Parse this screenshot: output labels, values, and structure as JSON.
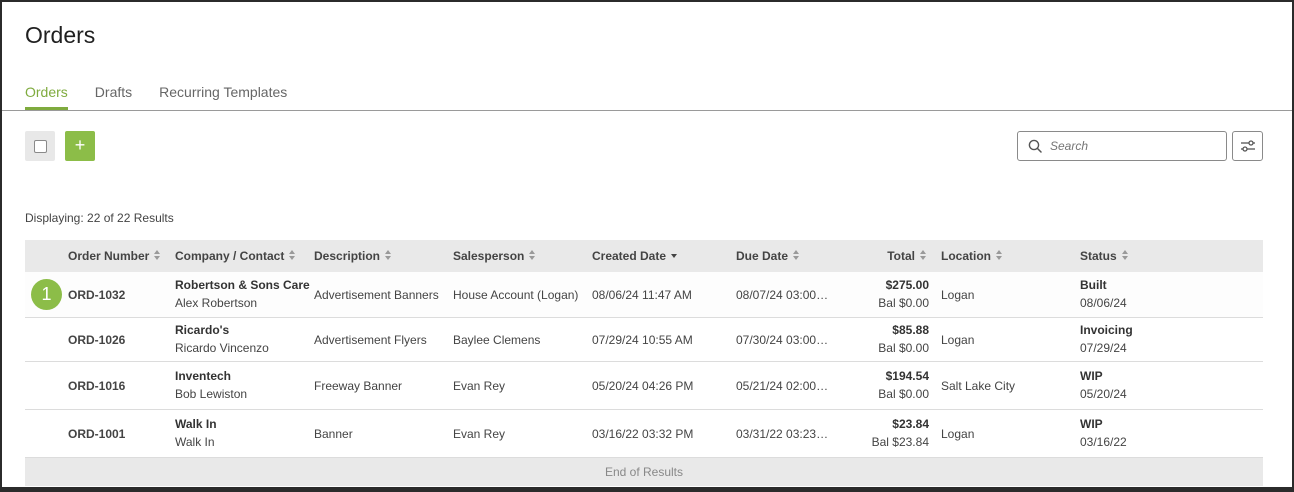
{
  "page": {
    "title": "Orders"
  },
  "tabs": [
    {
      "label": "Orders",
      "active": true
    },
    {
      "label": "Drafts",
      "active": false
    },
    {
      "label": "Recurring Templates",
      "active": false
    }
  ],
  "toolbar": {
    "add_label": "+",
    "search_placeholder": "Search",
    "search_icon": "search-icon",
    "filter_icon": "sliders-icon"
  },
  "results": {
    "label": "Displaying: 22 of 22 Results"
  },
  "columns": {
    "order_number": "Order Number",
    "company_contact": "Company / Contact",
    "description": "Description",
    "salesperson": "Salesperson",
    "created_date": "Created Date",
    "due_date": "Due Date",
    "total": "Total",
    "location": "Location",
    "status": "Status"
  },
  "rows": [
    {
      "badge": "1",
      "order": "ORD-1032",
      "company": "Robertson & Sons Care",
      "contact": "Alex Robertson",
      "description": "Advertisement Banners",
      "salesperson": "House Account (Logan)",
      "created": "08/06/24 11:47 AM",
      "due": "08/07/24 03:00…",
      "total": "$275.00",
      "balance": "Bal $0.00",
      "location": "Logan",
      "status": "Built",
      "status_date": "08/06/24"
    },
    {
      "order": "ORD-1026",
      "company": "Ricardo's",
      "contact": "Ricardo Vincenzo",
      "description": "Advertisement Flyers",
      "salesperson": "Baylee Clemens",
      "created": "07/29/24 10:55 AM",
      "due": "07/30/24 03:00…",
      "total": "$85.88",
      "balance": "Bal $0.00",
      "location": "Logan",
      "status": "Invoicing",
      "status_date": "07/29/24"
    },
    {
      "order": "ORD-1016",
      "company": "Inventech",
      "contact": "Bob Lewiston",
      "description": "Freeway Banner",
      "salesperson": "Evan Rey",
      "created": "05/20/24 04:26 PM",
      "due": "05/21/24 02:00…",
      "total": "$194.54",
      "balance": "Bal $0.00",
      "location": "Salt Lake City",
      "status": "WIP",
      "status_date": "05/20/24"
    },
    {
      "order": "ORD-1001",
      "company": "Walk In",
      "contact": "Walk In",
      "description": "Banner",
      "salesperson": "Evan Rey",
      "created": "03/16/22 03:32 PM",
      "due": "03/31/22 03:23…",
      "total": "$23.84",
      "balance": "Bal $23.84",
      "location": "Logan",
      "status": "WIP",
      "status_date": "03/16/22"
    }
  ],
  "footer": {
    "label": "End of Results"
  },
  "colors": {
    "accent": "#8cbd48",
    "header_bg": "#e9e9e9"
  }
}
